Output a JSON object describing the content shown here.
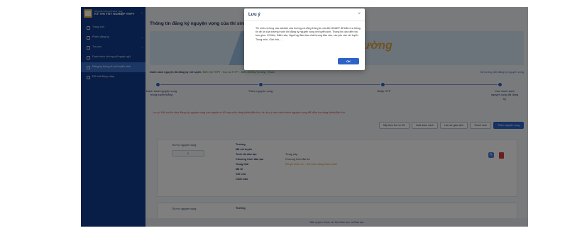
{
  "brand": {
    "line1": "BỘ GIÁO DỤC VÀ ĐÀO TẠO",
    "line2": "KỲ THI TỐT NGHIỆP THPT"
  },
  "sidebar": {
    "items": [
      {
        "label": "Trang chủ"
      },
      {
        "label": "Phiếu đăng ký",
        "arrow": "›"
      },
      {
        "label": "Tra cứu",
        "arrow": "›"
      },
      {
        "label": "Danh sách chứng chỉ ngoại ngữ"
      },
      {
        "label": "Đăng ký thông tin xét tuyển sinh"
      },
      {
        "label": "Đổi mã đăng nhập"
      }
    ]
  },
  "page": {
    "title": "Thông tin đăng ký nguyện vọng của thí sinh"
  },
  "banner": {
    "text": "ường"
  },
  "crumb": {
    "prefix": "Danh sách nguyện đã đăng ký xét tuyển:",
    "items": "Điểm thi THPT ; Học bạ THPT ; Điểm ĐGNL(Tư duy) ; Khác",
    "guide": "Tài hướng dẫn đăng ký nguyện vọng"
  },
  "steps": [
    {
      "label": "Danh sách nguyện vọng trúng tuyển thẳng"
    },
    {
      "label": "Thêm nguyện vọng"
    },
    {
      "label": "Nhập OTP"
    },
    {
      "label": "Xem danh sách nguyện vọng đã đăng ký"
    }
  ],
  "warning": "Lưu ý: Đối với thí sinh đăng ký nguyện vọng vào ngành có tổ hợp môn năng khiếu/đặc thù, xin lưu ý xem danh sách nguyện vọng để kiểm tra năng khiếu/đặc thù.",
  "actions": [
    "Sắp theo thứ tự NV",
    "Xuất danh sách",
    "Lịch sử giao dịch",
    "Thanh toán",
    "Thêm nguyện vọng"
  ],
  "cards": [
    {
      "order_label": "Thứ tự nguyện vọng",
      "order_value": "1",
      "fields": [
        {
          "k": "Trường",
          "v": ""
        },
        {
          "k": "Mã xét tuyển",
          "v": ""
        },
        {
          "k": "Trình độ đào tạo",
          "v": "Trung cấp"
        },
        {
          "k": "Chương trình đào tạo",
          "v": "Chương trình đại trà"
        },
        {
          "k": "Trạng thái",
          "v": "Đã ghi nhận NV - Đã nhận bằng thanh toán"
        },
        {
          "k": "Mã tổ",
          "v": ""
        },
        {
          "k": "Ghi chú",
          "v": ""
        },
        {
          "k": "Cảnh báo",
          "v": ""
        }
      ]
    },
    {
      "order_label": "Thứ tự nguyện vọng",
      "fields": [
        {
          "k": "Trường",
          "v": ""
        }
      ]
    }
  ],
  "footer": "Bản quyền thuộc về: Bộ Giáo dục và Đào tạo",
  "modal": {
    "title": "Lưu ý",
    "close": "×",
    "body": "Thí sinh vui lòng vào website của trường và cổng thông tin của Bộ GD&ĐT để kiểm tra thông tin đề án của trường trước khi đăng ký nguyện vọng xét tuyển sinh. Thông tin cần kiểm tra bao gồm: Chỉ tiêu, Điểm sàn, Ngưỡng đảm bảo chất lượng đầu vào, các yêu cầu xét tuyển Trung môn, Giới tính, ...",
    "ok": "OK"
  }
}
